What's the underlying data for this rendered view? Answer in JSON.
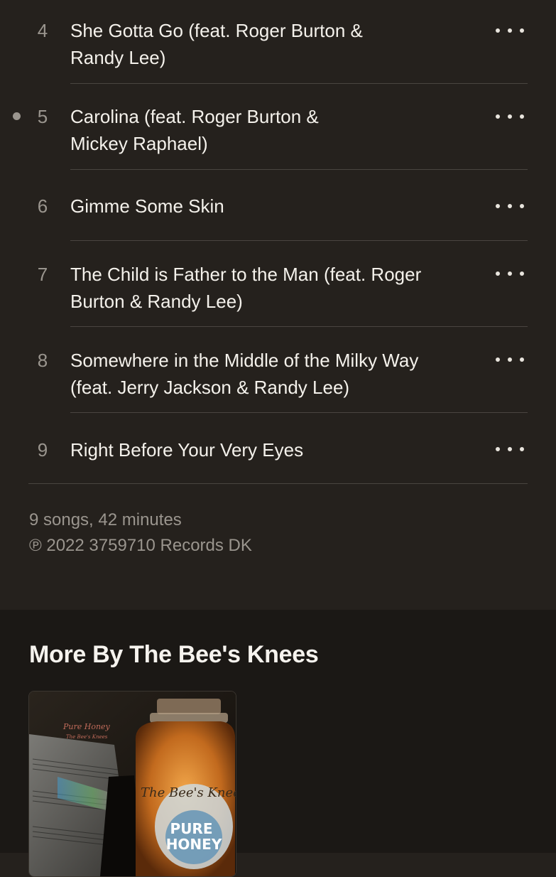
{
  "tracks": [
    {
      "number": "4",
      "title_line1": "She Gotta Go (feat. Roger Burton &",
      "title_line2": "Randy Lee)",
      "playing": false
    },
    {
      "number": "5",
      "title_line1": "Carolina (feat. Roger Burton &",
      "title_line2": "Mickey Raphael)",
      "playing": true
    },
    {
      "number": "6",
      "title_line1": "Gimme Some Skin",
      "title_line2": "",
      "playing": false
    },
    {
      "number": "7",
      "title_line1": "The Child is Father to the Man (feat. Roger",
      "title_line2": "Burton & Randy Lee)",
      "playing": false
    },
    {
      "number": "8",
      "title_line1": "Somewhere in the Middle of the Milky Way",
      "title_line2": "(feat. Jerry Jackson & Randy Lee)",
      "playing": false
    },
    {
      "number": "9",
      "title_line1": "Right Before Your Very Eyes",
      "title_line2": "",
      "playing": false
    }
  ],
  "album_info": {
    "summary": "9 songs, 42 minutes",
    "copyright": "℗ 2022 3759710 Records DK"
  },
  "more_by": {
    "heading": "More By The Bee's Knees",
    "albums": [
      {
        "cover_text_title": "Pure Honey",
        "cover_text_artist": "The Bee's Knees",
        "jar_script": "The Bee's Knees",
        "jar_label": "PURE HONEY"
      }
    ]
  },
  "colors": {
    "background": "#25211d",
    "section_background": "#1b1815",
    "secondary_text": "#9a958e",
    "primary_text": "#f4f1eb"
  },
  "icons": {
    "track_menu": "ellipsis-icon",
    "now_playing": "playing-dot-icon"
  }
}
